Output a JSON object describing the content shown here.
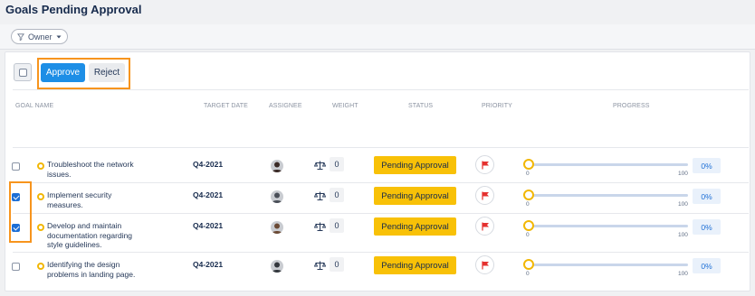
{
  "page": {
    "title": "Goals Pending Approval"
  },
  "filters": {
    "owner_label": "Owner"
  },
  "toolbar": {
    "approve_label": "Approve",
    "reject_label": "Reject"
  },
  "columns": {
    "goal_name": "GOAL NAME",
    "target_date": "TARGET DATE",
    "assignee": "ASSIGNEE",
    "weight": "WEIGHT",
    "status": "STATUS",
    "priority": "PRIORITY",
    "progress": "PROGRESS"
  },
  "progress_scale": {
    "min": "0",
    "max": "100"
  },
  "rows": [
    {
      "checked": false,
      "goal": "Troubleshoot the network issues.",
      "target": "Q4-2021",
      "weight": "0",
      "status": "Pending Approval",
      "progress": "0%",
      "progress_value": 0,
      "avatar_color": "#3a2a26"
    },
    {
      "checked": true,
      "goal": "Implement security measures.",
      "target": "Q4-2021",
      "weight": "0",
      "status": "Pending Approval",
      "progress": "0%",
      "progress_value": 0,
      "avatar_color": "#4a4f58"
    },
    {
      "checked": true,
      "goal": "Develop and maintain documentation regarding style guidelines.",
      "target": "Q4-2021",
      "weight": "0",
      "status": "Pending Approval",
      "progress": "0%",
      "progress_value": 0,
      "avatar_color": "#6b4a35"
    },
    {
      "checked": false,
      "goal": "Identifying the design problems in landing page.",
      "target": "Q4-2021",
      "weight": "0",
      "status": "Pending Approval",
      "progress": "0%",
      "progress_value": 0,
      "avatar_color": "#33373d"
    }
  ],
  "colors": {
    "accent": "#1d8ee6",
    "status_pending": "#f8c107",
    "highlight": "#f7941d",
    "flag": "#e5312f"
  },
  "icons": {
    "filter": "filter-icon",
    "dropdown": "chevron-down-icon",
    "goal": "goal-circle-icon",
    "weight": "scale-icon",
    "priority": "flag-icon"
  }
}
